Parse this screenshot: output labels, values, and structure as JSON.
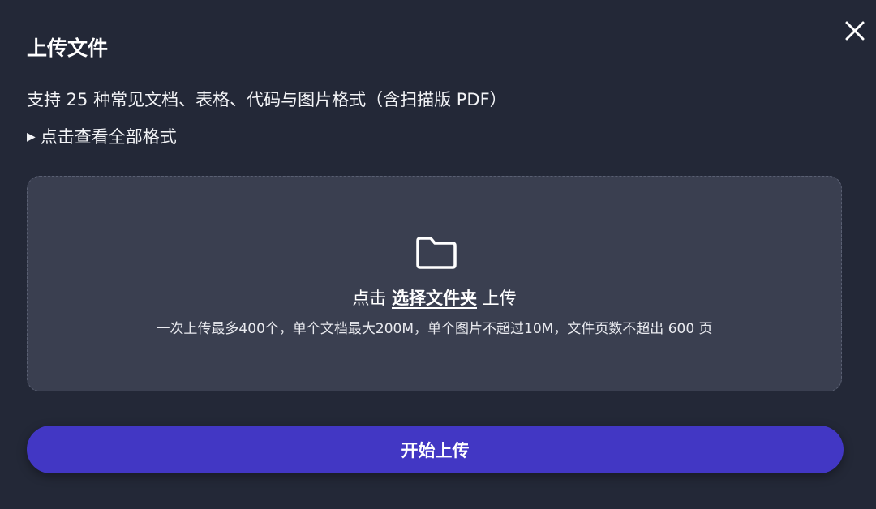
{
  "dialog": {
    "title": "上传文件",
    "close_icon": "close-icon"
  },
  "info": {
    "subtitle": "支持 25 种常见文档、表格、代码与图片格式（含扫描版 PDF）",
    "formats_triangle": "▶",
    "formats_link": "点击查看全部格式"
  },
  "dropzone": {
    "icon": "folder-icon",
    "prefix": "点击 ",
    "link": "选择文件夹",
    "suffix": " 上传",
    "limits": "一次上传最多400个，单个文档最大200M，单个图片不超过10M，文件页数不超出 600 页"
  },
  "actions": {
    "start_label": "开始上传"
  },
  "colors": {
    "background": "#232837",
    "dropzone": "#3a3f50",
    "primary_button": "#4237c4"
  }
}
